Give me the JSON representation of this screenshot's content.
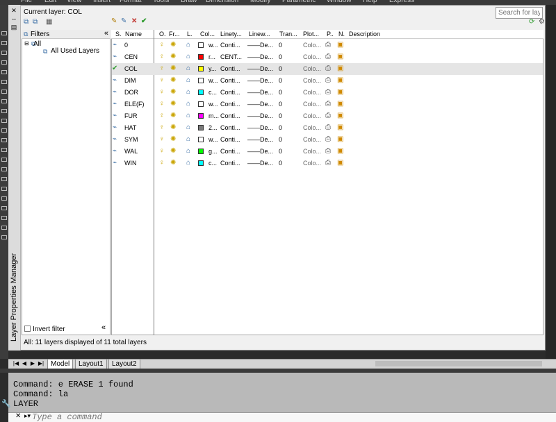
{
  "menu": [
    "File",
    "Edit",
    "View",
    "Insert",
    "Format",
    "Tools",
    "Draw",
    "Dimension",
    "Modify",
    "Parametric",
    "Window",
    "Help",
    "Express"
  ],
  "palette": {
    "current_layer": "Current layer: COL",
    "search_placeholder": "Search for layer",
    "title_vertical": "Layer Properties Manager",
    "filters_title": "Filters",
    "tree": {
      "all": "All",
      "all_used": "All Used Layers"
    },
    "invert_filter": "Invert filter",
    "status": "All: 11 layers displayed of 11 total layers",
    "columns": [
      "S.",
      "Name",
      "O.",
      "Fr...",
      "L.",
      "Col...",
      "Linety...",
      "Linew...",
      "Tran...",
      "Plot...",
      "P..",
      "N.",
      "Description"
    ]
  },
  "layers": [
    {
      "name": "0",
      "color_name": "w...",
      "color": "#ffffff",
      "linetype": "Conti...",
      "lineweight": "De...",
      "transparency": "0",
      "plot_style": "Colo...",
      "current": false
    },
    {
      "name": "CEN",
      "color_name": "r...",
      "color": "#ff0000",
      "linetype": "CENT...",
      "lineweight": "De...",
      "transparency": "0",
      "plot_style": "Colo...",
      "current": false
    },
    {
      "name": "COL",
      "color_name": "y...",
      "color": "#ffff00",
      "linetype": "Conti...",
      "lineweight": "De...",
      "transparency": "0",
      "plot_style": "Colo...",
      "current": true
    },
    {
      "name": "DIM",
      "color_name": "w...",
      "color": "#ffffff",
      "linetype": "Conti...",
      "lineweight": "De...",
      "transparency": "0",
      "plot_style": "Colo...",
      "current": false
    },
    {
      "name": "DOR",
      "color_name": "c...",
      "color": "#00ffff",
      "linetype": "Conti...",
      "lineweight": "De...",
      "transparency": "0",
      "plot_style": "Colo...",
      "current": false
    },
    {
      "name": "ELE(F)",
      "color_name": "w...",
      "color": "#ffffff",
      "linetype": "Conti...",
      "lineweight": "De...",
      "transparency": "0",
      "plot_style": "Colo...",
      "current": false
    },
    {
      "name": "FUR",
      "color_name": "m...",
      "color": "#ff00ff",
      "linetype": "Conti...",
      "lineweight": "De...",
      "transparency": "0",
      "plot_style": "Colo...",
      "current": false
    },
    {
      "name": "HAT",
      "color_name": "2...",
      "color": "#7a7a7a",
      "linetype": "Conti...",
      "lineweight": "De...",
      "transparency": "0",
      "plot_style": "Colo...",
      "current": false
    },
    {
      "name": "SYM",
      "color_name": "w...",
      "color": "#ffffff",
      "linetype": "Conti...",
      "lineweight": "De...",
      "transparency": "0",
      "plot_style": "Colo...",
      "current": false
    },
    {
      "name": "WAL",
      "color_name": "g...",
      "color": "#00ff00",
      "linetype": "Conti...",
      "lineweight": "De...",
      "transparency": "0",
      "plot_style": "Colo...",
      "current": false
    },
    {
      "name": "WIN",
      "color_name": "c...",
      "color": "#00ffff",
      "linetype": "Conti...",
      "lineweight": "De...",
      "transparency": "0",
      "plot_style": "Colo...",
      "current": false
    }
  ],
  "layout_tabs": [
    "Model",
    "Layout1",
    "Layout2"
  ],
  "command": {
    "history": [
      "Command: e ERASE 1 found",
      "Command: la",
      "LAYER"
    ],
    "placeholder": "Type a command"
  },
  "colors": {
    "current_check": "#2e9b2e",
    "selected_row": "#e5e5e5"
  }
}
